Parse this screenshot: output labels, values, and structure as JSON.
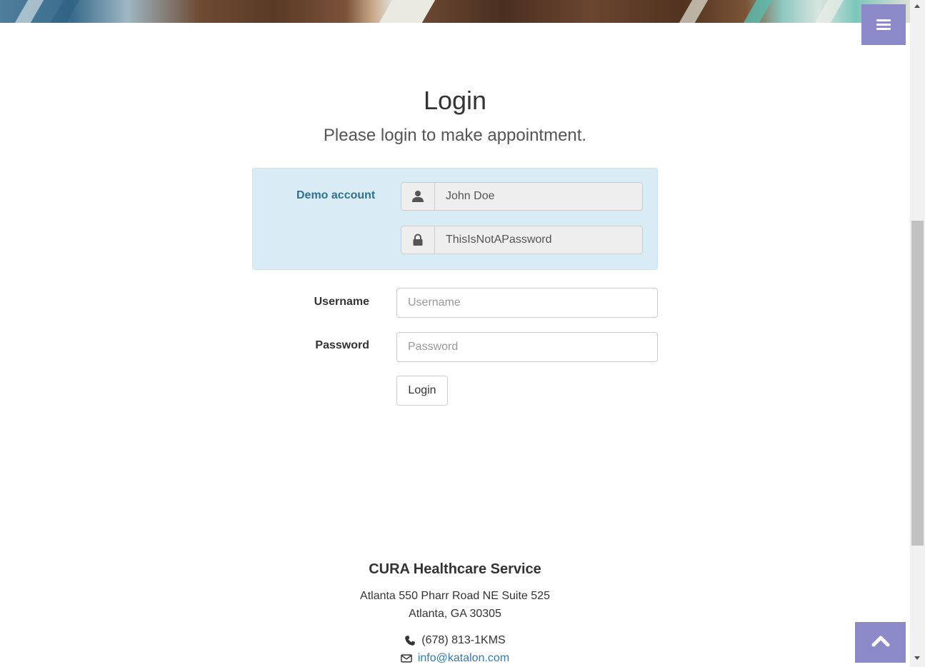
{
  "page": {
    "title": "Login",
    "subtitle": "Please login to make appointment."
  },
  "demo": {
    "label": "Demo account",
    "username_icon": "user-icon",
    "username_value": "John Doe",
    "password_icon": "lock-icon",
    "password_value": "ThisIsNotAPassword"
  },
  "form": {
    "username_label": "Username",
    "username_placeholder": "Username",
    "password_label": "Password",
    "password_placeholder": "Password",
    "login_button": "Login"
  },
  "footer": {
    "company": "CURA Healthcare Service",
    "address_line1": "Atlanta 550 Pharr Road NE Suite 525",
    "address_line2": "Atlanta, GA 30305",
    "phone_icon": "phone-icon",
    "phone": "(678) 813-1KMS",
    "email_icon": "envelope-icon",
    "email": "info@katalon.com"
  },
  "controls": {
    "menu_icon": "menu-icon",
    "to_top_icon": "chevron-up-icon"
  },
  "colors": {
    "accent": "#8c89c8",
    "demo_panel_bg": "#d9ecf5",
    "demo_label": "#31708f",
    "link": "#337ab7"
  }
}
